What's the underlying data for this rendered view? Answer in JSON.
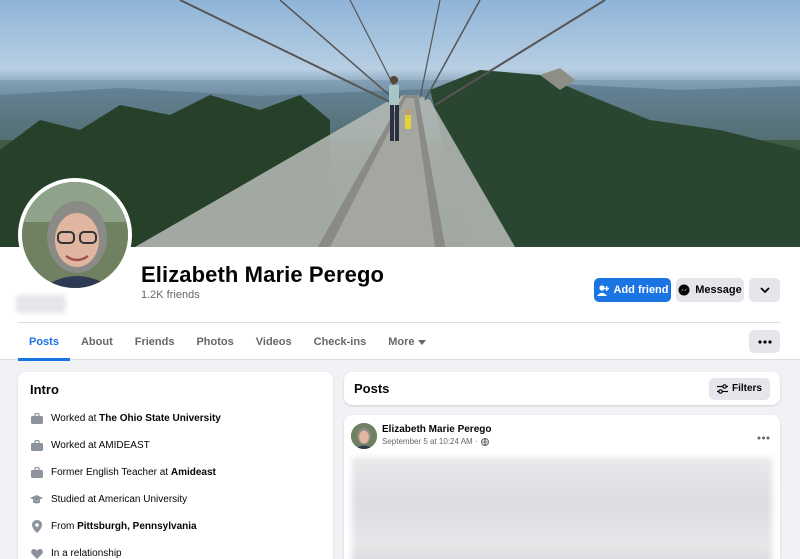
{
  "profile": {
    "name": "Elizabeth Marie Perego",
    "friends": "1.2K friends"
  },
  "actions": {
    "add_friend": "Add friend",
    "message": "Message"
  },
  "tabs": [
    {
      "label": "Posts"
    },
    {
      "label": "About"
    },
    {
      "label": "Friends"
    },
    {
      "label": "Photos"
    },
    {
      "label": "Videos"
    },
    {
      "label": "Check-ins"
    },
    {
      "label": "More"
    }
  ],
  "intro": {
    "title": "Intro",
    "items": [
      {
        "icon": "briefcase-icon",
        "prefix": "Worked at ",
        "bold": "The Ohio State University"
      },
      {
        "icon": "briefcase-icon",
        "prefix": "Worked at AMIDEAST",
        "bold": ""
      },
      {
        "icon": "briefcase-icon",
        "prefix": "Former English Teacher at ",
        "bold": "Amideast"
      },
      {
        "icon": "graduation-cap-icon",
        "prefix": "Studied at American University",
        "bold": ""
      },
      {
        "icon": "location-pin-icon",
        "prefix": "From ",
        "bold": "Pittsburgh, Pennsylvania"
      },
      {
        "icon": "heart-icon",
        "prefix": "In a relationship",
        "bold": ""
      }
    ]
  },
  "posts": {
    "title": "Posts",
    "filters_label": "Filters",
    "post": {
      "author": "Elizabeth Marie Perego",
      "timestamp": "September 5 at 10:24 AM ·"
    }
  },
  "colors": {
    "accent": "#1b74e4",
    "button_gray": "#e4e6eb",
    "page_bg": "#f0f2f5"
  }
}
